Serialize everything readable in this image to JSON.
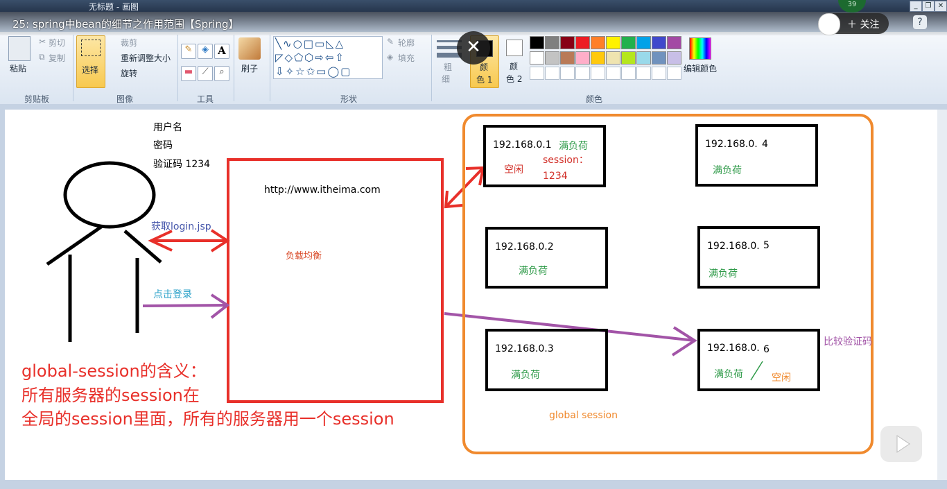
{
  "window": {
    "title": "无标题 - 画图"
  },
  "video": {
    "title": "25: spring中bean的细节之作用范围【Spring】",
    "follow_label": "关注",
    "level_badge": "39",
    "help": "?"
  },
  "ribbon": {
    "clipboard": {
      "paste": "粘贴",
      "cut": "剪切",
      "copy": "复制",
      "group": "剪贴板"
    },
    "image": {
      "select": "选择",
      "crop": "裁剪",
      "resize": "重新调整大小",
      "rotate": "旋转",
      "group": "图像"
    },
    "tools": {
      "group": "工具"
    },
    "brushes": {
      "label": "刷子"
    },
    "shapes": {
      "outline": "轮廓",
      "fill": "填充",
      "group": "形状"
    },
    "size": {
      "label_1": "粗",
      "label_2": "细"
    },
    "colors": {
      "color1_1": "颜",
      "color1_2": "色 1",
      "color2_1": "颜",
      "color2_2": "色 2",
      "edit": "编辑颜色",
      "group": "颜色",
      "palette_row1": [
        "#000000",
        "#7f7f7f",
        "#880015",
        "#ed1c24",
        "#ff7f27",
        "#fff200",
        "#22b14c",
        "#00a2e8",
        "#3f48cc",
        "#a349a4"
      ],
      "palette_row2": [
        "#ffffff",
        "#c3c3c3",
        "#b97a57",
        "#ffaec9",
        "#ffc90e",
        "#efe4b0",
        "#b5e61d",
        "#99d9ea",
        "#7092be",
        "#c8bfe7"
      ]
    }
  },
  "drawing": {
    "form_user": "用户名",
    "form_pwd": "密码",
    "form_captcha": "验证码  1234",
    "url": "http://www.itheima.com",
    "get_login": "获取login.jsp",
    "click_login": "点击登录",
    "lb": "负载均衡",
    "servers": [
      {
        "ip": "192.168.0.1",
        "status": "满负荷",
        "extra1": "空闲",
        "extra2": "session：",
        "extra3": "1234"
      },
      {
        "ip": "192.168.0.2",
        "status": "满负荷"
      },
      {
        "ip": "192.168.0.3",
        "status": "满负荷"
      },
      {
        "ip": "192.168.0.",
        "suffix": "4",
        "status": "满负荷"
      },
      {
        "ip": "192.168.0.",
        "suffix": "5",
        "status": "满负荷"
      },
      {
        "ip": "192.168.0.",
        "suffix": "6",
        "status": "满负荷",
        "extra1": "空闲"
      }
    ],
    "compare": "比较验证码",
    "global_session": "global session",
    "note1": "global-session的含义：",
    "note2": "所有服务器的session在",
    "note3": "全局的session里面，所有的服务器用一个session"
  }
}
